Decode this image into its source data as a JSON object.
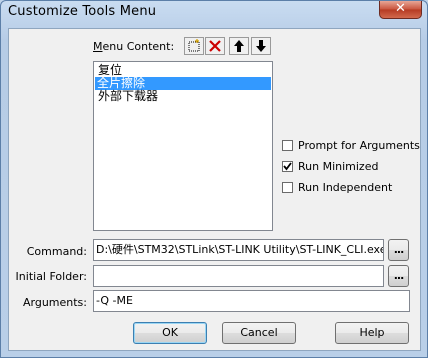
{
  "window": {
    "title": "Customize Tools Menu",
    "close_glyph": "✕"
  },
  "menu_content": {
    "label_underlined": "M",
    "label_rest": "enu Content:",
    "toolbar": [
      {
        "name": "new-item-icon",
        "glyph": ""
      },
      {
        "name": "delete-icon",
        "glyph": "✕"
      },
      {
        "name": "move-up-icon",
        "glyph": "🡑"
      },
      {
        "name": "move-down-icon",
        "glyph": "🡓"
      }
    ],
    "items": [
      {
        "label": "复位",
        "selected": false
      },
      {
        "label": "全片擦除",
        "selected": true
      },
      {
        "label": "外部下载器",
        "selected": false
      }
    ]
  },
  "options": {
    "prompt_for_arguments": {
      "label": "Prompt for  Arguments",
      "checked": false
    },
    "run_minimized": {
      "label": "Run Minimized",
      "checked": true
    },
    "run_independent": {
      "label": "Run Independent",
      "checked": false
    }
  },
  "fields": {
    "command": {
      "label": "Command:",
      "value": "D:\\硬件\\STM32\\STLink\\ST-LINK Utility\\ST-LINK_CLI.exe",
      "browse": "..."
    },
    "initial_folder": {
      "label": "Initial Folder:",
      "value": "",
      "browse": "..."
    },
    "arguments": {
      "label": "Arguments:",
      "value": "-Q -ME"
    }
  },
  "buttons": {
    "ok": "OK",
    "cancel": "Cancel",
    "help": "Help"
  }
}
